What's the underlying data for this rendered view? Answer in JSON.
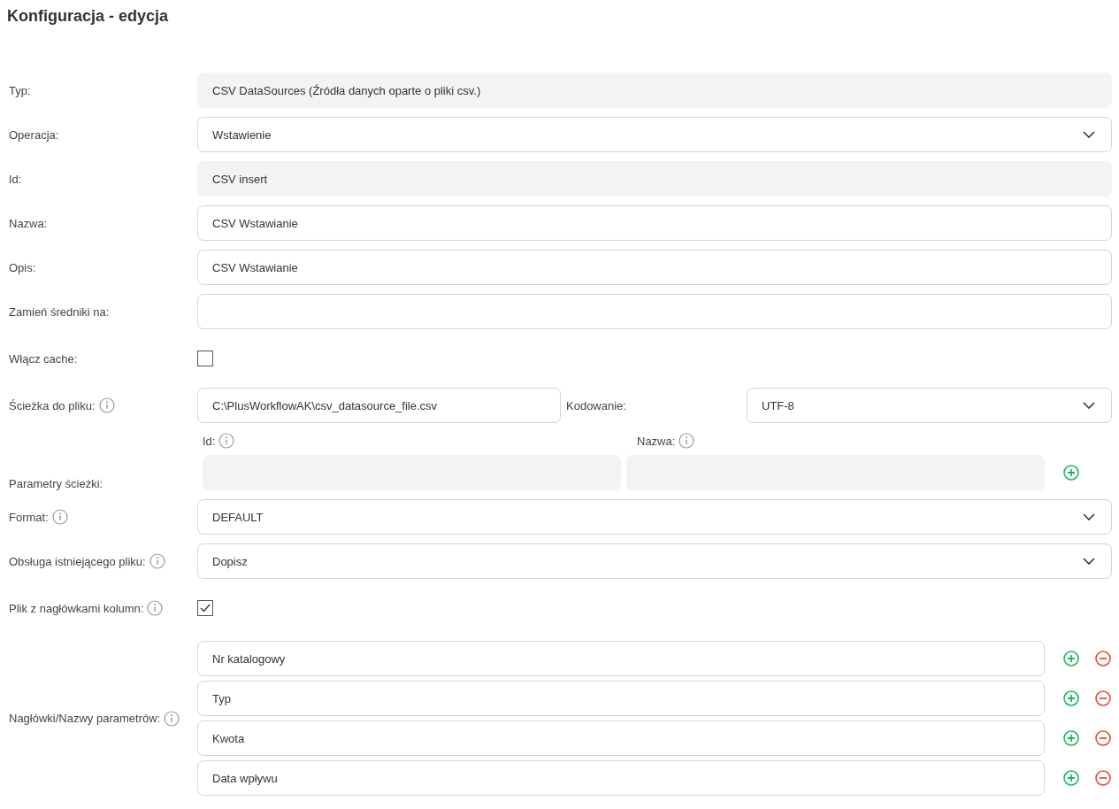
{
  "title": "Konfiguracja - edycja",
  "fields": [
    {
      "kind": "readonly",
      "label": "Typ:",
      "info": false,
      "value": "CSV DataSources (Źródła danych oparte o pliki csv.)"
    },
    {
      "kind": "select",
      "label": "Operacja:",
      "info": false,
      "value": "Wstawienie"
    },
    {
      "kind": "readonly",
      "label": "Id:",
      "info": false,
      "value": "CSV insert"
    },
    {
      "kind": "input",
      "label": "Nazwa:",
      "info": false,
      "value": "CSV Wstawianie"
    },
    {
      "kind": "input",
      "label": "Opis:",
      "info": false,
      "value": "CSV Wstawianie"
    },
    {
      "kind": "input",
      "label": "Zamień średniki na:",
      "info": false
    },
    {
      "kind": "checkbox",
      "label": "Włącz cache:",
      "info": false,
      "checked": false
    },
    {
      "kind": "path",
      "label": "Ścieżka do pliku:",
      "info": true,
      "value": "C:\\PlusWorkflowAK\\csv_datasource_file.csv",
      "encoding_label": "Kodowanie:",
      "encoding": "UTF-8"
    },
    {
      "kind": "params",
      "label": "Parametry ścieżki:",
      "info": false,
      "id_label": "Id:",
      "name_label": "Nazwa:"
    },
    {
      "kind": "select",
      "label": "Format:",
      "info": true,
      "value": "DEFAULT"
    },
    {
      "kind": "select",
      "label": "Obsługa istniejącego pliku:",
      "info": true,
      "value": "Dopisz"
    },
    {
      "kind": "checkbox",
      "label": "Plik z nagłówkami kolumn:",
      "info": true,
      "checked": true
    },
    {
      "kind": "headers",
      "label": "Nagłówki/Nazwy parametrów:",
      "info": true,
      "values": [
        "Nr katalogowy",
        "Typ",
        "Kwota",
        "Data wpływu"
      ]
    }
  ]
}
